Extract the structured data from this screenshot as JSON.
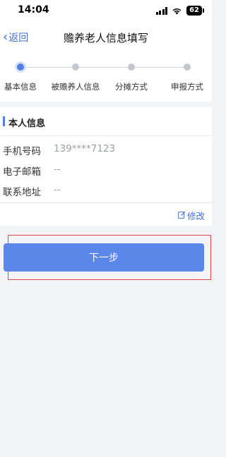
{
  "status_bar": {
    "time": "14:04",
    "battery": "62",
    "signal_icon": "cellular-signal-icon",
    "wifi_icon": "wifi-icon"
  },
  "nav": {
    "back_label": "返回",
    "title": "赡养老人信息填写"
  },
  "steps": [
    {
      "label": "基本信息",
      "active": true
    },
    {
      "label": "被赡养人信息",
      "active": false
    },
    {
      "label": "分摊方式",
      "active": false
    },
    {
      "label": "申报方式",
      "active": false
    }
  ],
  "section": {
    "title": "本人信息"
  },
  "info": [
    {
      "key": "手机号码",
      "value": "139****7123"
    },
    {
      "key": "电子邮箱",
      "value": "--"
    },
    {
      "key": "联系地址",
      "value": "--"
    }
  ],
  "edit": {
    "label": "修改",
    "icon": "edit-icon"
  },
  "next_button": {
    "label": "下一步"
  },
  "colors": {
    "accent": "#4f7ee6",
    "button": "#5b86ea",
    "highlight_border": "#e04848",
    "background": "#f3f4f8"
  }
}
